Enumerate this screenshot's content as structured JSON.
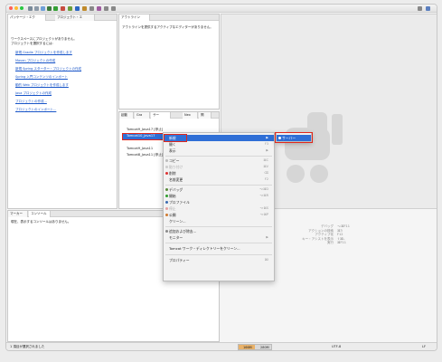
{
  "tabs_left": {
    "package_explorer": "パッケージ・エク",
    "project_explorer": "プロジェクト・エ"
  },
  "welcome": {
    "message_line1": "ワークスペースにプロジェクトがありません。",
    "message_line2": "プロジェクトを選択するには:",
    "links": [
      "新規 Gradle プロジェクトを作成します",
      "Maven プロジェクトの作成",
      "新規 Spring スターター・プロジェクトの作成",
      "Spring 入門コンテンツのインポート",
      "動的 Web プロジェクトを作成します",
      "Java プロジェクトの作成",
      "プロジェクトの作成...",
      "プロジェクトのインポート..."
    ]
  },
  "outline": {
    "tab": "アウトライン",
    "message": "アウトラインを提供するアクティブなエディターがありません。"
  },
  "servers_view": {
    "tabs": [
      "起動",
      "Gra",
      "サー",
      "Nex",
      "問"
    ],
    "items": [
      "Tomcat9_Java17 [停止]",
      "Tomcat10_Java17",
      "Tomcat9_Java11",
      "Tomcat8_Java11 [停止]"
    ],
    "selected_index": 1
  },
  "bottom_view": {
    "tab_markers": "マーカー",
    "tab_console": "コンソール",
    "message": "現在、表示するコンソールはありません。"
  },
  "context_menu": {
    "items": [
      {
        "label": "新規",
        "key": "",
        "submenu": true
      },
      {
        "label": "開く",
        "key": "F3"
      },
      {
        "label": "表示",
        "key": "",
        "submenu": true
      },
      {
        "sep": true
      },
      {
        "label": "コピー",
        "key": "⌘C"
      },
      {
        "label": "貼り付け",
        "key": "⌘V",
        "disabled": true
      },
      {
        "label": "削除",
        "key": "⌫"
      },
      {
        "label": "名前変更",
        "key": "F2"
      },
      {
        "sep": true
      },
      {
        "label": "デバッグ",
        "key": "⌥⌘D"
      },
      {
        "label": "開始",
        "key": "⌥⌘R"
      },
      {
        "label": "プロファイル",
        "key": ""
      },
      {
        "label": "停止",
        "key": "⌥⌘S",
        "disabled": true
      },
      {
        "label": "公開",
        "key": "⌥⌘P"
      },
      {
        "label": "クリーン...",
        "key": ""
      },
      {
        "sep": true
      },
      {
        "label": "追加および除去...",
        "key": ""
      },
      {
        "label": "モニター",
        "key": "",
        "submenu": true
      },
      {
        "sep": true
      },
      {
        "label": "Tomcat ワーク・ディレクトリーをクリーン...",
        "key": ""
      },
      {
        "sep": true
      },
      {
        "label": "プロパティー",
        "key": "⌘I"
      }
    ],
    "submenu_item": "サーバー"
  },
  "shortcuts": {
    "labels": [
      "デバッグ",
      "アクションの検索",
      "アクティブ化",
      "キー・アシストを表示",
      "実行"
    ],
    "keys": [
      "⌥⌘F11",
      "⌘3",
      "F12",
      "⇧⌘L",
      "⌘F11"
    ]
  },
  "status_bar": {
    "left": "1 項目が選択されました",
    "memory_used": "166M",
    "memory_total": "280M",
    "encoding": "UTF-8",
    "line_ending": "LF"
  },
  "colors": {
    "accent_red": "#e0261b",
    "selection_blue": "#2f6fd6",
    "link_blue": "#1a56c8"
  }
}
